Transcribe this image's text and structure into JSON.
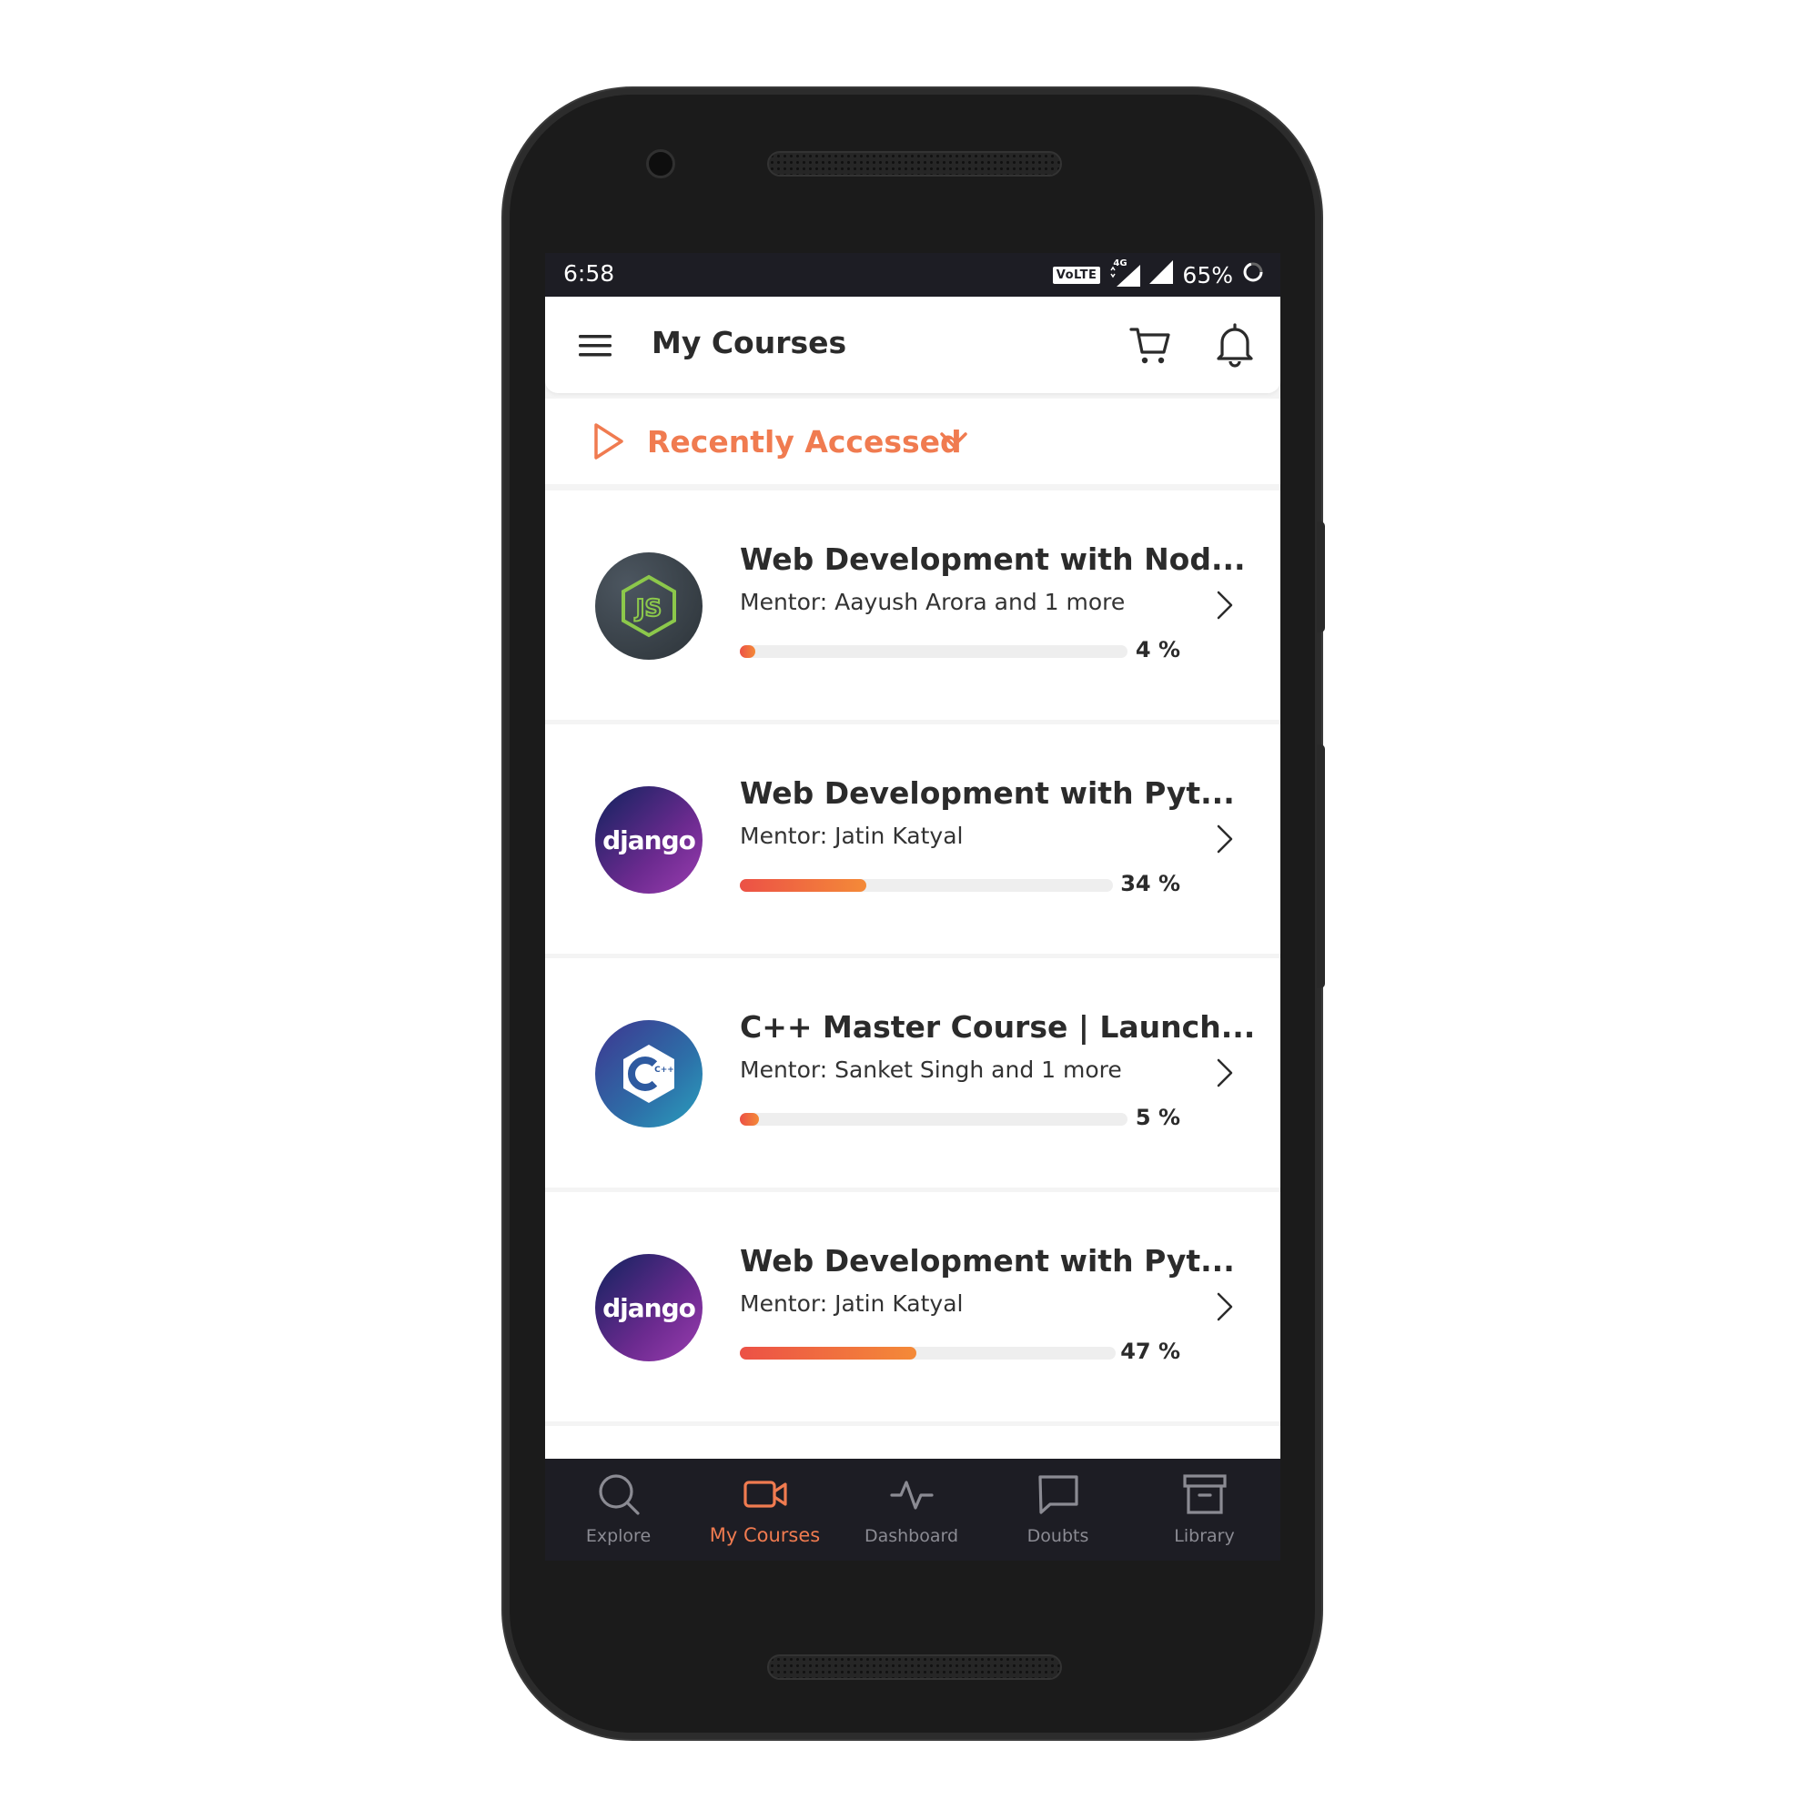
{
  "status_bar": {
    "time": "6:58",
    "volte": "VoLTE",
    "network": "4G",
    "battery": "65%"
  },
  "app_bar": {
    "title": "My Courses"
  },
  "filter": {
    "label": "Recently Accessed"
  },
  "courses": [
    {
      "title": "Web Development with Nod...",
      "mentor": "Mentor: Aayush Arora and 1 more",
      "progress_label": "4 %",
      "progress": 4,
      "logo": "JS"
    },
    {
      "title": "Web Development with Pyt...",
      "mentor": "Mentor: Jatin Katyal",
      "progress_label": "34 %",
      "progress": 34,
      "logo": "django"
    },
    {
      "title": "C++ Master Course | Launch...",
      "mentor": "Mentor: Sanket Singh and 1 more",
      "progress_label": "5 %",
      "progress": 5,
      "logo": "C++"
    },
    {
      "title": "Web Development with Pyt...",
      "mentor": "Mentor: Jatin Katyal",
      "progress_label": "47 %",
      "progress": 47,
      "logo": "django"
    }
  ],
  "bottom_nav": [
    {
      "label": "Explore",
      "icon": "search-icon",
      "active": false
    },
    {
      "label": "My Courses",
      "icon": "video-camera-icon",
      "active": true
    },
    {
      "label": "Dashboard",
      "icon": "activity-icon",
      "active": false
    },
    {
      "label": "Doubts",
      "icon": "chat-bubble-icon",
      "active": false
    },
    {
      "label": "Library",
      "icon": "archive-box-icon",
      "active": false
    }
  ],
  "colors": {
    "accent": "#f07b50",
    "nav_bg": "#1d1d24",
    "progress_start": "#ec5146",
    "progress_end": "#f48a38"
  }
}
